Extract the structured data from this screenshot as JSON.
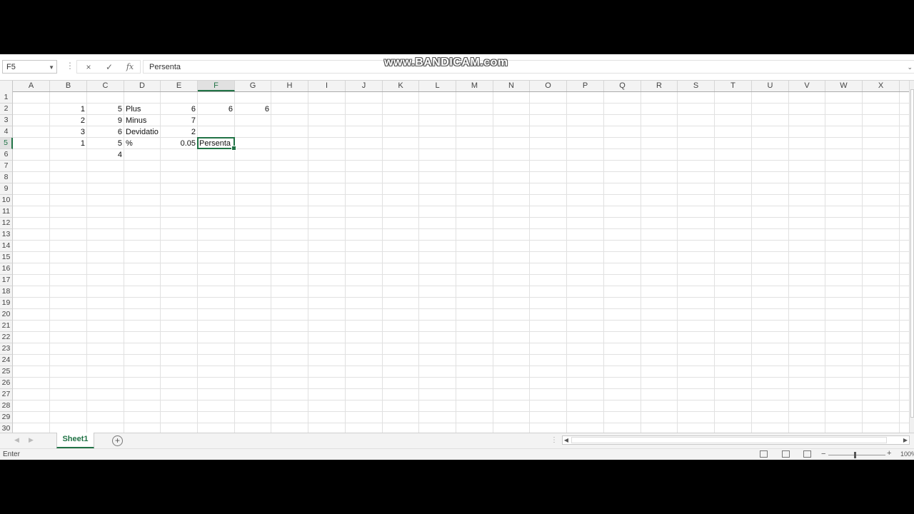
{
  "formula_bar": {
    "name_box": "F5",
    "cancel_icon": "×",
    "enter_icon": "✓",
    "fx_label": "fx",
    "value": "Persenta"
  },
  "watermark": "www.BANDICAM.com",
  "columns": [
    "A",
    "B",
    "C",
    "D",
    "E",
    "F",
    "G",
    "H",
    "I",
    "J",
    "K",
    "L",
    "M",
    "N",
    "O",
    "P",
    "Q",
    "R",
    "S",
    "T",
    "U",
    "V",
    "W",
    "X"
  ],
  "rows": [
    "1",
    "2",
    "3",
    "4",
    "5",
    "6",
    "7",
    "8",
    "9",
    "10",
    "11",
    "12",
    "13",
    "14",
    "15",
    "16",
    "17",
    "18",
    "19",
    "20",
    "21",
    "22",
    "23",
    "24",
    "25",
    "26",
    "27",
    "28",
    "29",
    "30"
  ],
  "selected": {
    "column": "F",
    "row": "5"
  },
  "cells": [
    {
      "ref": "B2",
      "value": "1",
      "type": "num"
    },
    {
      "ref": "C2",
      "value": "5",
      "type": "num"
    },
    {
      "ref": "D2",
      "value": "Plus",
      "type": "txt"
    },
    {
      "ref": "E2",
      "value": "6",
      "type": "num"
    },
    {
      "ref": "F2",
      "value": "6",
      "type": "num"
    },
    {
      "ref": "G2",
      "value": "6",
      "type": "num"
    },
    {
      "ref": "B3",
      "value": "2",
      "type": "num"
    },
    {
      "ref": "C3",
      "value": "9",
      "type": "num"
    },
    {
      "ref": "D3",
      "value": "Minus",
      "type": "txt"
    },
    {
      "ref": "E3",
      "value": "7",
      "type": "num"
    },
    {
      "ref": "B4",
      "value": "3",
      "type": "num"
    },
    {
      "ref": "C4",
      "value": "6",
      "type": "num"
    },
    {
      "ref": "D4",
      "value": "Devidatio",
      "type": "txt"
    },
    {
      "ref": "E4",
      "value": "2",
      "type": "num"
    },
    {
      "ref": "B5",
      "value": "1",
      "type": "num"
    },
    {
      "ref": "C5",
      "value": "5",
      "type": "num"
    },
    {
      "ref": "D5",
      "value": "%",
      "type": "txt"
    },
    {
      "ref": "E5",
      "value": "0.05",
      "type": "num"
    },
    {
      "ref": "C6",
      "value": "4",
      "type": "num"
    }
  ],
  "active_cell": {
    "ref": "F5",
    "value": "Persenta"
  },
  "sheet_tabs": {
    "active": "Sheet1",
    "add_label": "+"
  },
  "status": {
    "mode": "Enter",
    "zoom": "100%"
  },
  "colors": {
    "accent": "#217346"
  }
}
